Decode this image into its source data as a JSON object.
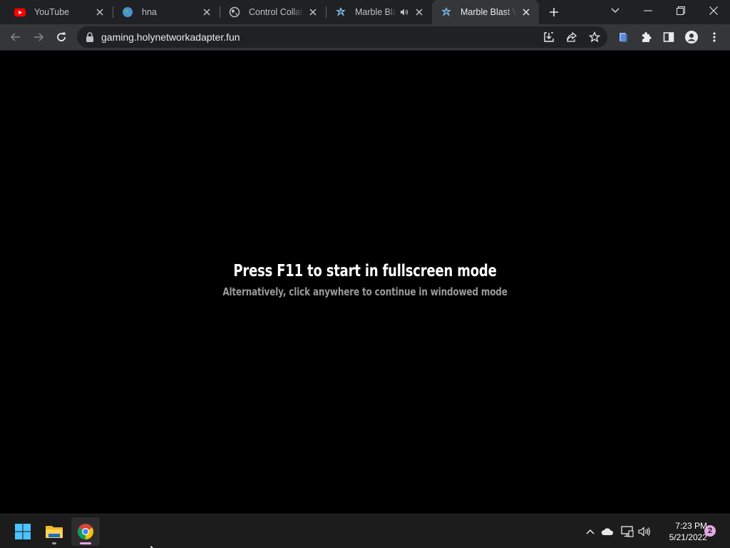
{
  "browser": {
    "tabs": [
      {
        "title": "YouTube",
        "icon": "youtube-icon",
        "active": false
      },
      {
        "title": "hna",
        "icon": "globe-icon",
        "active": false
      },
      {
        "title": "Control Collabo",
        "icon": "globe-icon",
        "active": false
      },
      {
        "title": "Marble Blas",
        "icon": "marble-blast-icon",
        "audio": true,
        "active": false
      },
      {
        "title": "Marble Blast We",
        "icon": "marble-blast-icon",
        "active": true
      }
    ],
    "address_bar": {
      "url": "gaming.holynetworkadapter.fun"
    }
  },
  "page": {
    "headline": "Press F11 to start in fullscreen mode",
    "subline": "Alternatively, click anywhere to continue in windowed mode"
  },
  "taskbar": {
    "apps": [
      "start-icon",
      "file-explorer-icon",
      "chrome-icon"
    ],
    "clock_time": "7:23 PM",
    "clock_date": "5/21/2022",
    "notification_count": "2"
  },
  "colors": {
    "tab_strip": "#202124",
    "toolbar": "#35363a",
    "page_background": "#000000",
    "headline": "#ffffff",
    "subline": "#9a9a9a",
    "taskbar": "#1c1c1c",
    "notification_badge": "#e3a9e6"
  }
}
